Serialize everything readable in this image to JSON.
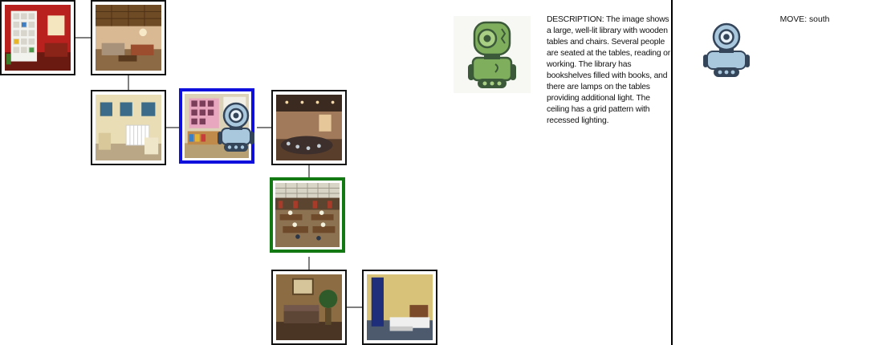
{
  "map": {
    "tiles": [
      {
        "id": "tile-red-room",
        "scene": "red room with white shelves",
        "state": "normal"
      },
      {
        "id": "tile-living-room",
        "scene": "living room with wooden ceiling",
        "state": "normal"
      },
      {
        "id": "tile-nursery",
        "scene": "nursery with crib",
        "state": "normal"
      },
      {
        "id": "tile-kids-room",
        "scene": "kids room with posters",
        "state": "current"
      },
      {
        "id": "tile-lounge",
        "scene": "lounge with round counter",
        "state": "normal"
      },
      {
        "id": "tile-library",
        "scene": "library with tables",
        "state": "target"
      },
      {
        "id": "tile-den",
        "scene": "den with sofa and plant",
        "state": "normal"
      },
      {
        "id": "tile-bedroom",
        "scene": "bedroom with twin beds",
        "state": "normal"
      }
    ],
    "colors": {
      "current_border": "#1010dd",
      "target_border": "#137a13"
    }
  },
  "description": {
    "text": "DESCRIPTION: The image shows a large, well-lit library with wooden tables and chairs. Several people are seated at the tables, reading or working. The library has bookshelves filled with books, and there are lamps on the tables providing additional light. The ceiling has a grid pattern with recessed lighting.",
    "robot_icon": "green-robot-icon"
  },
  "move": {
    "label": "MOVE: south",
    "robot_icon": "blue-robot-icon"
  }
}
